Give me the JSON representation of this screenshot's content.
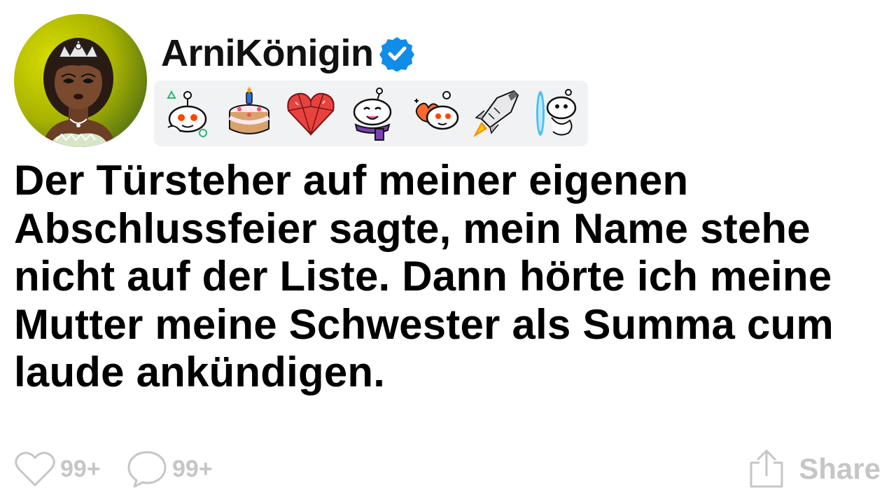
{
  "post": {
    "username": "ArniKönigin",
    "verified": true,
    "title": "Der Türsteher auf meiner eigenen Abschlussfeier sagte, mein Name stehe nicht auf der Liste. Dann hörte ich meine Mutter meine Schwester als Summa cum laude ankündigen."
  },
  "awards": [
    {
      "icon": "snoo-triangle-award-icon"
    },
    {
      "icon": "birthday-cake-award-icon"
    },
    {
      "icon": "crystal-heart-award-icon"
    },
    {
      "icon": "snoo-scarf-award-icon"
    },
    {
      "icon": "snoo-balloons-award-icon"
    },
    {
      "icon": "rocket-award-icon"
    },
    {
      "icon": "snoo-portal-award-icon"
    }
  ],
  "footer": {
    "likes": "99+",
    "comments": "99+",
    "share_label": "Share"
  },
  "colors": {
    "verified_badge": "#0f8de8",
    "muted_icon": "#c6c6c6",
    "award_strip_bg": "#f1f2f4",
    "avatar_bg": "#a9b300"
  }
}
